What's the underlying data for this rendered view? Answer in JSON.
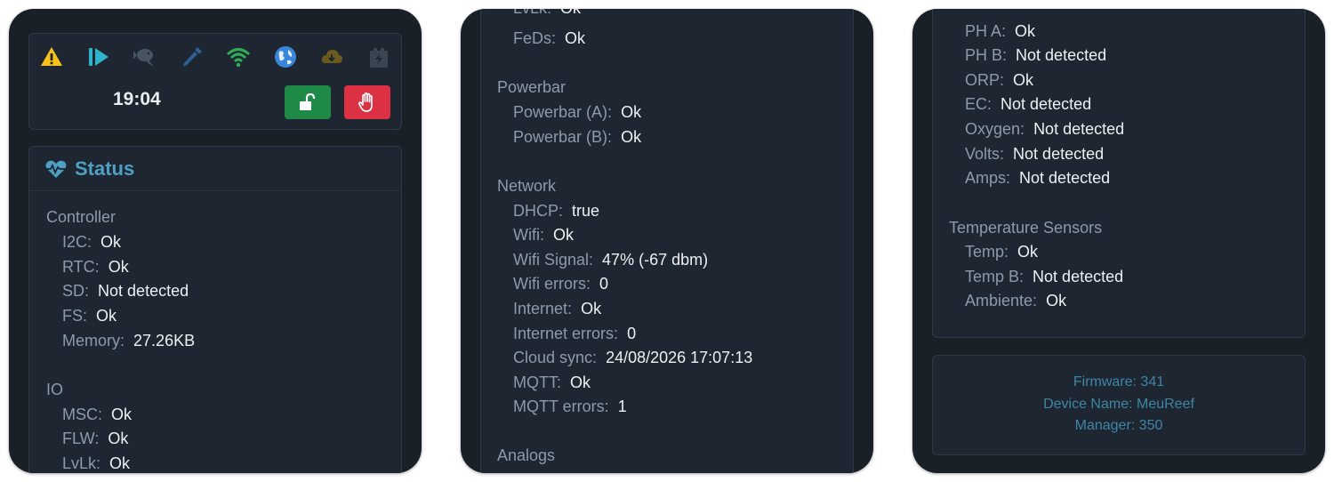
{
  "panel1": {
    "icons": [
      "warning-icon",
      "play-pause-icon",
      "fish-icon",
      "dosing-pipette-icon",
      "wifi-icon",
      "globe-icon",
      "cloud-download-icon",
      "battery-charge-icon"
    ],
    "clock": "19:04",
    "status_title": "Status",
    "sections": [
      {
        "title": "Controller",
        "items": [
          {
            "label": "I2C:",
            "value": "Ok"
          },
          {
            "label": "RTC:",
            "value": "Ok"
          },
          {
            "label": "SD:",
            "value": "Not detected"
          },
          {
            "label": "FS:",
            "value": "Ok"
          },
          {
            "label": "Memory:",
            "value": "27.26KB"
          }
        ]
      },
      {
        "title": "IO",
        "items": [
          {
            "label": "MSC:",
            "value": "Ok"
          },
          {
            "label": "FLW:",
            "value": "Ok"
          },
          {
            "label": "LvLk:",
            "value": "Ok"
          }
        ]
      }
    ]
  },
  "panel2": {
    "partial_top": {
      "label": "LvLk:",
      "value": "Ok"
    },
    "feds": {
      "label": "FeDs:",
      "value": "Ok"
    },
    "sections": [
      {
        "title": "Powerbar",
        "items": [
          {
            "label": "Powerbar (A):",
            "value": "Ok"
          },
          {
            "label": "Powerbar (B):",
            "value": "Ok"
          }
        ]
      },
      {
        "title": "Network",
        "items": [
          {
            "label": "DHCP:",
            "value": "true"
          },
          {
            "label": "Wifi:",
            "value": "Ok"
          },
          {
            "label": "Wifi Signal:",
            "value": "47% (-67 dbm)"
          },
          {
            "label": "Wifi errors:",
            "value": "0"
          },
          {
            "label": "Internet:",
            "value": "Ok"
          },
          {
            "label": "Internet errors:",
            "value": "0"
          },
          {
            "label": "Cloud sync:",
            "value": "24/08/2026 17:07:13"
          },
          {
            "label": "MQTT:",
            "value": "Ok"
          },
          {
            "label": "MQTT errors:",
            "value": "1"
          }
        ]
      },
      {
        "title": "Analogs",
        "items": []
      }
    ]
  },
  "panel3": {
    "analogs": [
      {
        "label": "PH A:",
        "value": "Ok"
      },
      {
        "label": "PH B:",
        "value": "Not detected"
      },
      {
        "label": "ORP:",
        "value": "Ok"
      },
      {
        "label": "EC:",
        "value": "Not detected"
      },
      {
        "label": "Oxygen:",
        "value": "Not detected"
      },
      {
        "label": "Volts:",
        "value": "Not detected"
      },
      {
        "label": "Amps:",
        "value": "Not detected"
      }
    ],
    "temp_title": "Temperature Sensors",
    "temps": [
      {
        "label": "Temp:",
        "value": "Ok"
      },
      {
        "label": "Temp B:",
        "value": "Not detected"
      },
      {
        "label": "Ambiente:",
        "value": "Ok"
      }
    ],
    "footer": {
      "firmware": "Firmware: 341",
      "device_name": "Device Name: MeuReef",
      "manager": "Manager: 350"
    }
  },
  "colors": {
    "background": "#1a2028",
    "card": "#1d2631",
    "label": "#8c9bab",
    "value": "#eef1f4",
    "accent": "#4f9fc3",
    "unlock": "#1f8a47",
    "stop": "#dc3043"
  }
}
